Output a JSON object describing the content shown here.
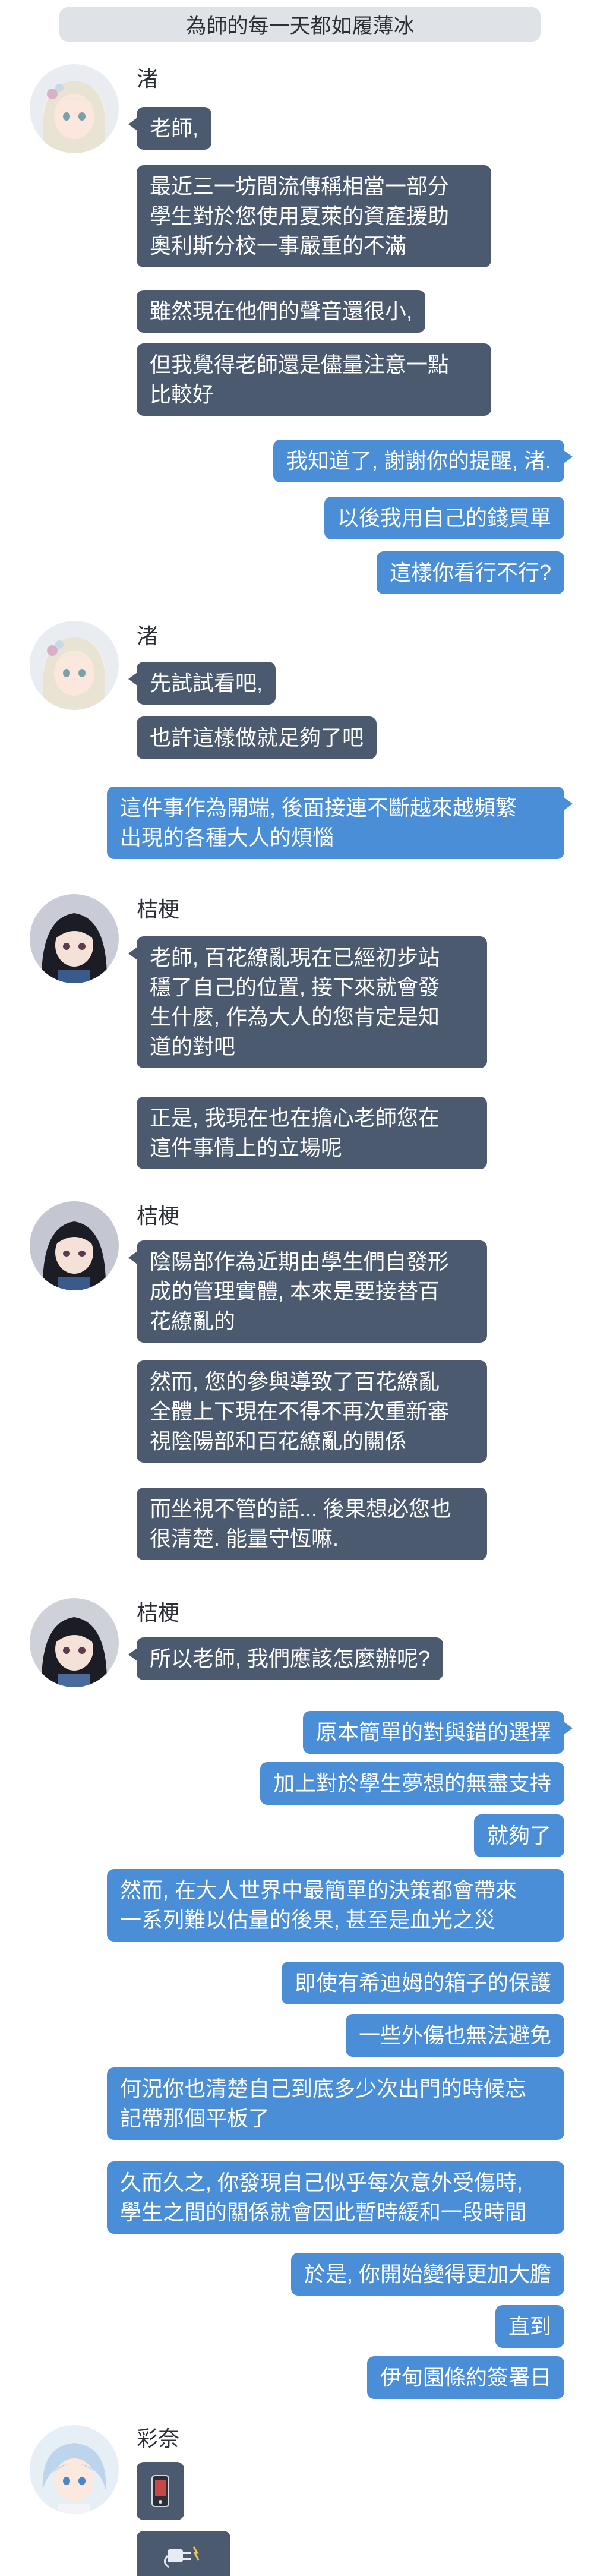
{
  "title": "為師的每一天都如履薄冰",
  "senders": {
    "s1": "渚",
    "s2": "渚",
    "s3": "桔梗",
    "s4": "桔梗",
    "s5": "桔梗",
    "s6": "彩奈"
  },
  "messages": [
    "老師,",
    "最近三一坊間流傳稱相當一部分\n學生對於您使用夏萊的資產援助\n奧利斯分校一事嚴重的不滿",
    "雖然現在他們的聲音還很小,",
    "但我覺得老師還是儘量注意一點\n比較好",
    "我知道了, 謝謝你的提醒, 渚.",
    "以後我用自己的錢買單",
    "這樣你看行不行?",
    "先試試看吧,",
    "也許這樣做就足夠了吧",
    "這件事作為開端, 後面接連不斷越來越頻繁\n出現的各種大人的煩惱",
    "老師, 百花繚亂現在已經初步站\n穩了自己的位置, 接下來就會發\n生什麼, 作為大人的您肯定是知\n道的對吧",
    "正是, 我現在也在擔心老師您在\n這件事情上的立場呢",
    "陰陽部作為近期由學生們自發形\n成的管理實體, 本來是要接替百\n花繚亂的",
    "然而, 您的參與導致了百花繚亂\n全體上下現在不得不再次重新審\n視陰陽部和百花繚亂的關係",
    "而坐視不管的話... 後果想必您也\n很清楚. 能量守恆嘛.",
    "所以老師, 我們應該怎麼辦呢?",
    "原本簡單的對與錯的選擇",
    "加上對於學生夢想的無盡支持",
    "就夠了",
    "然而, 在大人世界中最簡單的決策都會帶來\n一系列難以估量的後果, 甚至是血光之災",
    "即使有希迪姆的箱子的保護",
    "一些外傷也無法避免",
    "何況你也清楚自己到底多少次出門的時候忘\n記帶那個平板了",
    "久而久之, 你發現自己似乎每次意外受傷時,\n學生之間的關係就會因此暫時緩和一段時間",
    "於是, 你開始變得更加大膽",
    "直到",
    "伊甸園條約簽署日"
  ],
  "icons": {
    "sticker1": "phone-icon",
    "sticker2": "plug-icon"
  },
  "colors": {
    "left_bubble": "#4b5a6e",
    "right_bubble": "#4a8ed8",
    "title_bg": "#dfe3e8"
  }
}
